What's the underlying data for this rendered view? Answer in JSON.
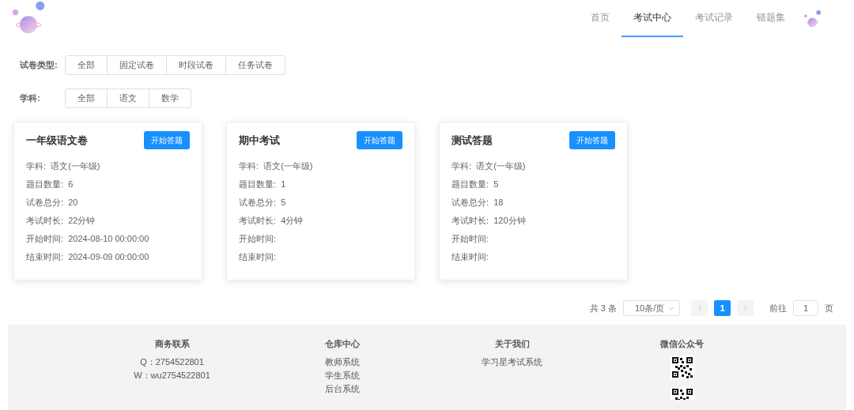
{
  "nav": [
    {
      "label": "首页",
      "selected": false
    },
    {
      "label": "考试中心",
      "selected": true
    },
    {
      "label": "考试记录",
      "selected": false
    },
    {
      "label": "错题集",
      "selected": false
    }
  ],
  "filters": [
    {
      "label": "试卷类型:",
      "options": [
        {
          "label": "全部",
          "selected": false
        },
        {
          "label": "固定试卷",
          "selected": false
        },
        {
          "label": "时段试卷",
          "selected": false
        },
        {
          "label": "任务试卷",
          "selected": false
        }
      ]
    },
    {
      "label": "学科:",
      "options": [
        {
          "label": "全部",
          "selected": false
        },
        {
          "label": "语文",
          "selected": false
        },
        {
          "label": "数学",
          "selected": false
        }
      ]
    }
  ],
  "papers": [
    {
      "title": "一年级语文卷",
      "button": "开始答题",
      "fields": [
        {
          "label": "学科:",
          "value": "语文(一年级)"
        },
        {
          "label": "题目数量:",
          "value": "6"
        },
        {
          "label": "试卷总分:",
          "value": "20"
        },
        {
          "label": "考试时长:",
          "value": "22分钟"
        },
        {
          "label": "开始时间:",
          "value": "2024-08-10 00:00:00"
        },
        {
          "label": "结束时间:",
          "value": "2024-09-09 00:00:00"
        }
      ]
    },
    {
      "title": "期中考试",
      "button": "开始答题",
      "fields": [
        {
          "label": "学科:",
          "value": "语文(一年级)"
        },
        {
          "label": "题目数量:",
          "value": "1"
        },
        {
          "label": "试卷总分:",
          "value": "5"
        },
        {
          "label": "考试时长:",
          "value": "4分钟"
        },
        {
          "label": "开始时间:"
        },
        {
          "label": "结束时间:"
        }
      ]
    },
    {
      "title": "测试答题",
      "button": "开始答题",
      "fields": [
        {
          "label": "学科:",
          "value": "语文(一年级)"
        },
        {
          "label": "题目数量:",
          "value": "5"
        },
        {
          "label": "试卷总分:",
          "value": "18"
        },
        {
          "label": "考试时长:",
          "value": "120分钟"
        },
        {
          "label": "开始时间:"
        },
        {
          "label": "结束时间:"
        }
      ]
    }
  ],
  "pagination": {
    "total": "共 3 条",
    "page_size": "10条/页",
    "pages": [
      {
        "label": "1",
        "selected": true
      }
    ],
    "goto_label": "前往",
    "goto_value": "1",
    "goto_suffix": "页"
  },
  "footer": [
    {
      "title": "商务联系",
      "lines": [
        "Q：2754522801",
        "W：wu2754522801"
      ]
    },
    {
      "title": "仓库中心",
      "lines": [
        "教师系统",
        "学生系统",
        "后台系统"
      ]
    },
    {
      "title": "关于我们",
      "lines": [
        "学习星考试系统"
      ]
    },
    {
      "title": "微信公众号",
      "qr_codes": [
        {
          "kind": "qr"
        },
        {
          "kind": "qr"
        }
      ]
    }
  ]
}
